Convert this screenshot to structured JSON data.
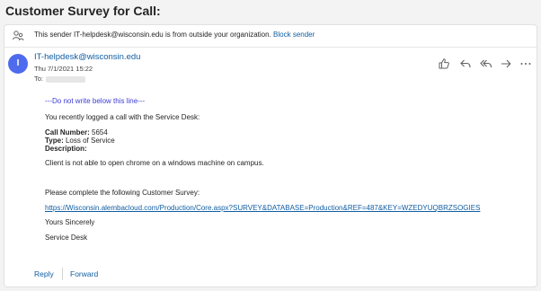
{
  "subject": "Customer Survey for Call:",
  "banner": {
    "text": "This sender IT-helpdesk@wisconsin.edu is from outside your organization.",
    "link": "Block sender"
  },
  "sender": {
    "initial": "I",
    "email": "IT-helpdesk@wisconsin.edu",
    "date": "Thu 7/1/2021 15:22",
    "to_label": "To:"
  },
  "actions": [
    "like-icon",
    "reply-icon",
    "reply-all-icon",
    "forward-icon",
    "more-icon"
  ],
  "body": {
    "note": "---Do not write below this line---",
    "intro": "You recently logged a call with the Service Desk:",
    "call_number_label": "Call Number:",
    "call_number": "5654",
    "type_label": "Type:",
    "type": "Loss of Service",
    "description_label": "Description:",
    "description": "Client is not able to open chrome on a windows machine on campus.",
    "survey_prompt": "Please complete the following Customer Survey:",
    "survey_link": "https://Wisconsin.alembacloud.com/Production/Core.aspx?SURVEY&DATABASE=Production&REF=487&KEY=WZEDYUQBRZSOGIES",
    "closing": "Yours Sincerely",
    "signature": "Service Desk"
  },
  "footer": {
    "reply": "Reply",
    "forward": "Forward"
  },
  "colors": {
    "accent": "#115ea3",
    "avatar": "#4f6bed",
    "note": "#3b3bd6"
  }
}
